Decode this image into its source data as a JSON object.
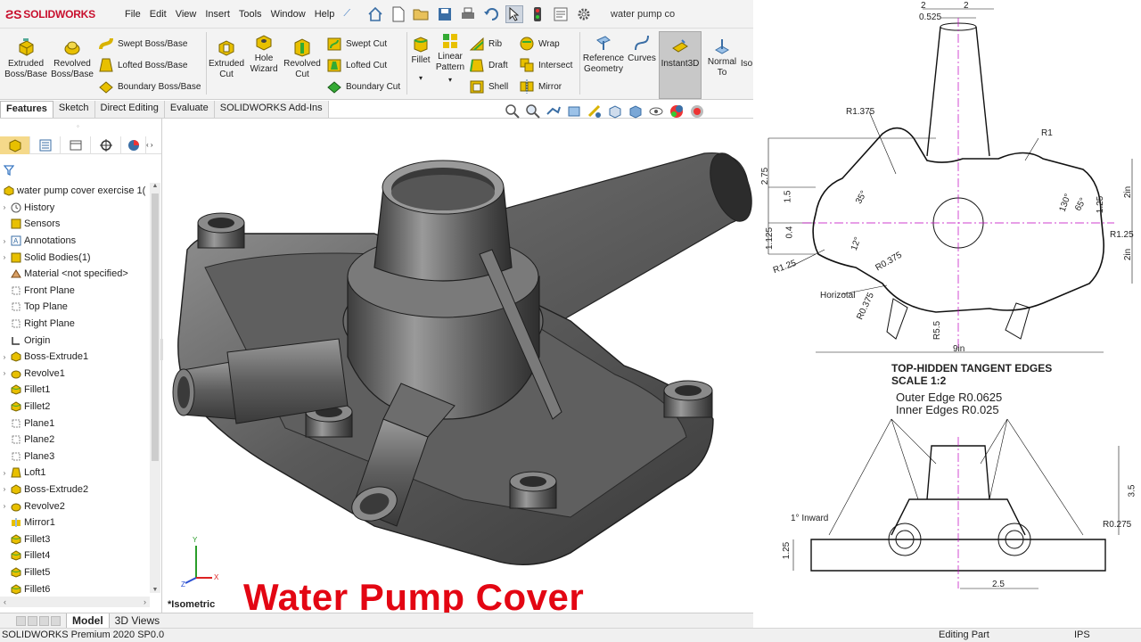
{
  "app": {
    "logo": "SOLIDWORKS",
    "menus": [
      "File",
      "Edit",
      "View",
      "Insert",
      "Tools",
      "Window",
      "Help"
    ],
    "doc_title": "water pump co"
  },
  "ribbon": {
    "extruded_boss": "Extruded Boss/Base",
    "revolved_boss": "Revolved Boss/Base",
    "swept_boss": "Swept Boss/Base",
    "lofted_boss": "Lofted Boss/Base",
    "boundary_boss": "Boundary Boss/Base",
    "extruded_cut": "Extruded Cut",
    "hole_wizard": "Hole Wizard",
    "revolved_cut": "Revolved Cut",
    "swept_cut": "Swept Cut",
    "lofted_cut": "Lofted Cut",
    "boundary_cut": "Boundary Cut",
    "fillet": "Fillet",
    "linear_pattern": "Linear Pattern",
    "rib": "Rib",
    "draft": "Draft",
    "shell": "Shell",
    "wrap": "Wrap",
    "intersect": "Intersect",
    "mirror": "Mirror",
    "reference_geometry": "Reference Geometry",
    "curves": "Curves",
    "instant3d": "Instant3D",
    "normal_to": "Normal To",
    "iso": "Iso"
  },
  "tabs": [
    "Features",
    "Sketch",
    "Direct Editing",
    "Evaluate",
    "SOLIDWORKS Add-Ins"
  ],
  "tree": {
    "root": "water pump cover exercise 1(",
    "items": [
      {
        "label": "History",
        "icon": "history-icon",
        "expand": true
      },
      {
        "label": "Sensors",
        "icon": "sensor-icon",
        "expand": false
      },
      {
        "label": "Annotations",
        "icon": "annotation-icon",
        "expand": true
      },
      {
        "label": "Solid Bodies(1)",
        "icon": "solid-bodies-icon",
        "expand": true
      },
      {
        "label": "Material <not specified>",
        "icon": "material-icon",
        "expand": false
      },
      {
        "label": "Front Plane",
        "icon": "plane-icon",
        "expand": false
      },
      {
        "label": "Top Plane",
        "icon": "plane-icon",
        "expand": false
      },
      {
        "label": "Right Plane",
        "icon": "plane-icon",
        "expand": false
      },
      {
        "label": "Origin",
        "icon": "origin-icon",
        "expand": false
      },
      {
        "label": "Boss-Extrude1",
        "icon": "extrude-icon",
        "expand": true
      },
      {
        "label": "Revolve1",
        "icon": "revolve-icon",
        "expand": true
      },
      {
        "label": "Fillet1",
        "icon": "fillet-icon",
        "expand": false
      },
      {
        "label": "Fillet2",
        "icon": "fillet-icon",
        "expand": false
      },
      {
        "label": "Plane1",
        "icon": "plane-icon",
        "expand": false
      },
      {
        "label": "Plane2",
        "icon": "plane-icon",
        "expand": false
      },
      {
        "label": "Plane3",
        "icon": "plane-icon",
        "expand": false
      },
      {
        "label": "Loft1",
        "icon": "loft-icon",
        "expand": true
      },
      {
        "label": "Boss-Extrude2",
        "icon": "extrude-icon",
        "expand": true
      },
      {
        "label": "Revolve2",
        "icon": "revolve-icon",
        "expand": true
      },
      {
        "label": "Mirror1",
        "icon": "mirror-icon",
        "expand": false
      },
      {
        "label": "Fillet3",
        "icon": "fillet-icon",
        "expand": false
      },
      {
        "label": "Fillet4",
        "icon": "fillet-icon",
        "expand": false
      },
      {
        "label": "Fillet5",
        "icon": "fillet-icon",
        "expand": false
      },
      {
        "label": "Fillet6",
        "icon": "fillet-icon",
        "expand": false
      }
    ]
  },
  "viewport": {
    "view_label": "*Isometric",
    "title": "Water Pump Cover",
    "axis_x": "X",
    "axis_y": "Y",
    "axis_z": "Z"
  },
  "bottom_tabs": [
    "Model",
    "3D Views"
  ],
  "status": {
    "product": "SOLIDWORKS Premium 2020 SP0.0",
    "mode": "Editing Part",
    "units": "IPS"
  },
  "drawing": {
    "dims_top": [
      "2",
      "2",
      "0.525"
    ],
    "dim_labels": [
      "R1.375",
      "R1",
      "2.75",
      "1.5",
      "0.4",
      "1.125",
      "35°",
      "12°",
      "R1.25",
      "R0.375",
      "Horizotal",
      "R0.375",
      "R5.5",
      "9in",
      "130°",
      "65°",
      "1.25",
      "2in",
      "2in",
      "R1.25"
    ],
    "view_caption": "TOP-HIDDEN TANGENT EDGES",
    "scale": "SCALE 1:2",
    "outer_edge": "Outer Edge R0.0625",
    "inner_edges": "Inner Edges R0.025",
    "front_dims": [
      "1° Inward",
      "3.5",
      "R0.275",
      "1.25",
      "2.5"
    ]
  },
  "colors": {
    "title_red": "#e30613",
    "accent_blue": "#3a78c2",
    "centerline_magenta": "#c000c0"
  }
}
